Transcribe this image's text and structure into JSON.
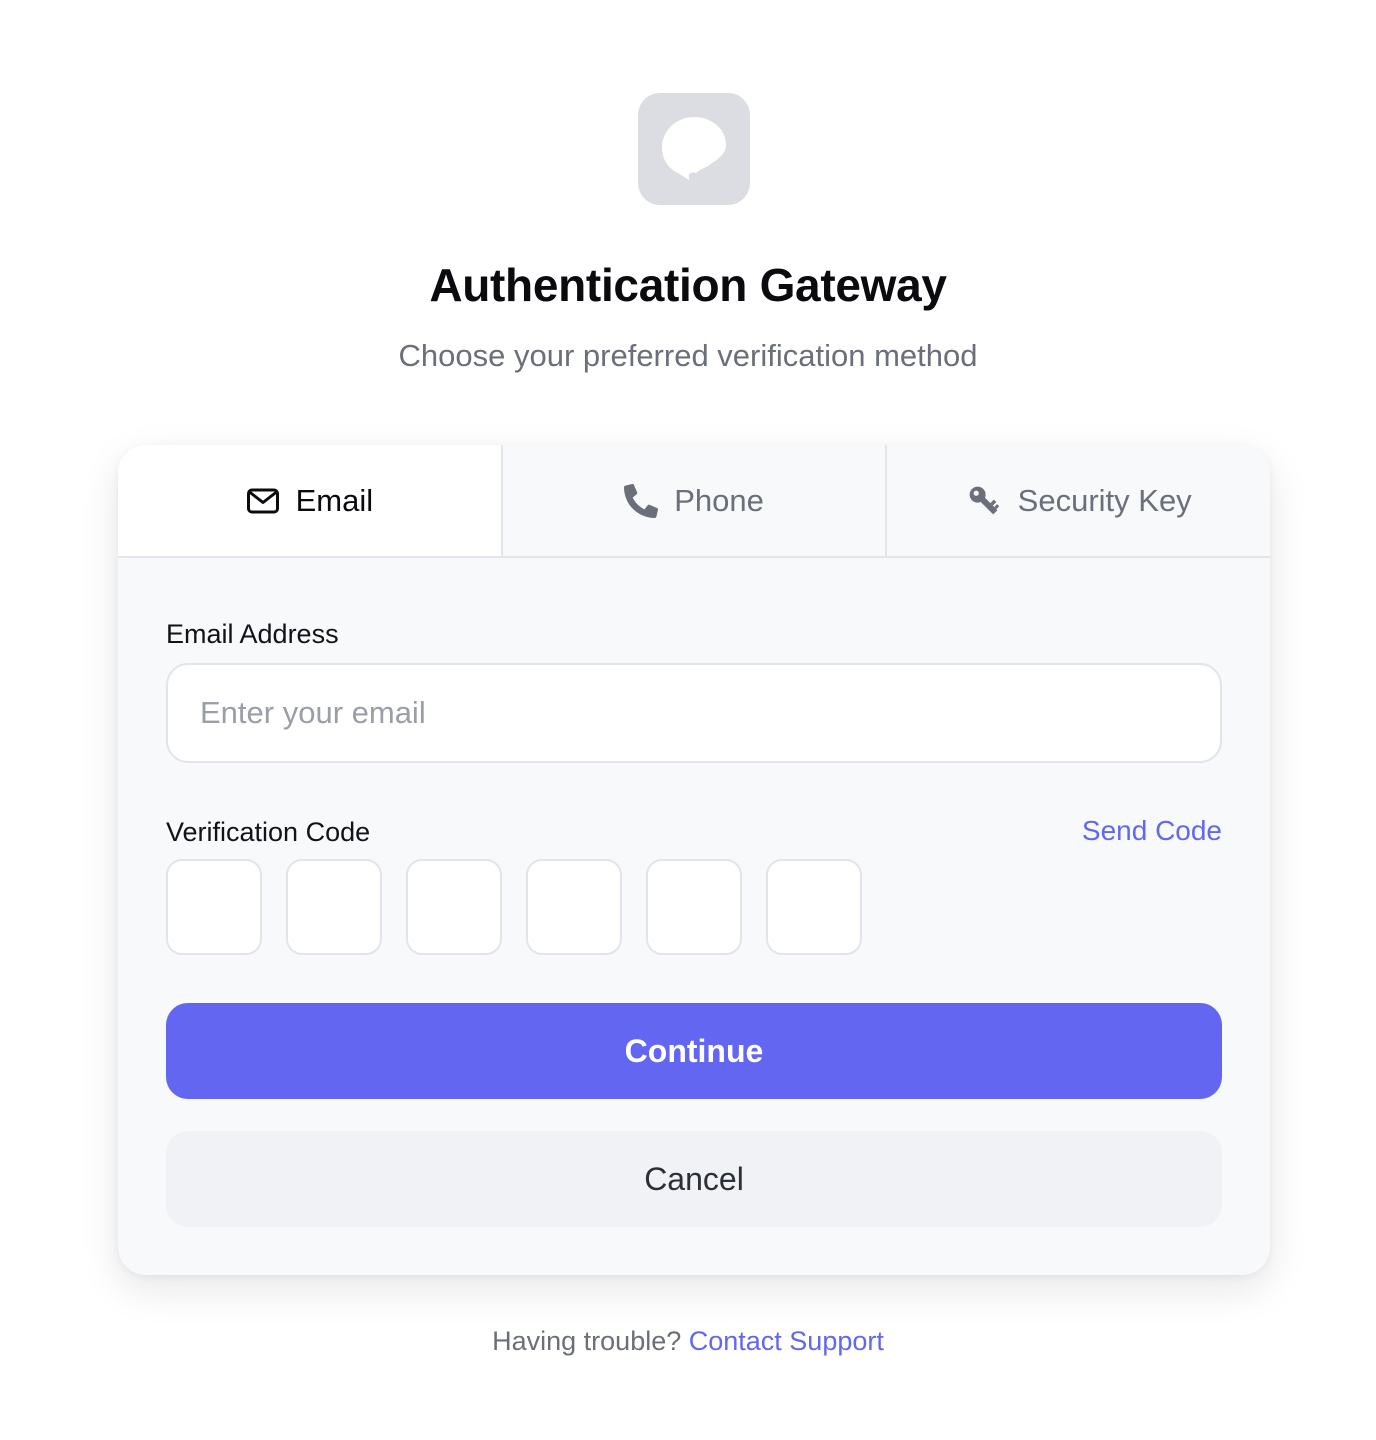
{
  "header": {
    "logo_icon": "chat-bubble-icon",
    "title": "Authentication Gateway",
    "subtitle": "Choose your preferred verification method"
  },
  "tabs": [
    {
      "label": "Email",
      "icon": "envelope-icon",
      "active": true
    },
    {
      "label": "Phone",
      "icon": "phone-icon",
      "active": false
    },
    {
      "label": "Security Key",
      "icon": "key-icon",
      "active": false
    }
  ],
  "form": {
    "email_label": "Email Address",
    "email_placeholder": "Enter your email",
    "email_value": "",
    "code_label": "Verification Code",
    "send_code_label": "Send Code",
    "code_digits": [
      "",
      "",
      "",
      "",
      "",
      ""
    ]
  },
  "actions": {
    "continue_label": "Continue",
    "cancel_label": "Cancel"
  },
  "footer": {
    "prompt": "Having trouble?",
    "link_label": "Contact Support"
  },
  "colors": {
    "accent": "#6366f1",
    "text_primary": "#0b0b0f",
    "text_muted": "#6b6f7a",
    "card_bg": "#f8f9fb",
    "logo_bg": "#dcdde2"
  }
}
